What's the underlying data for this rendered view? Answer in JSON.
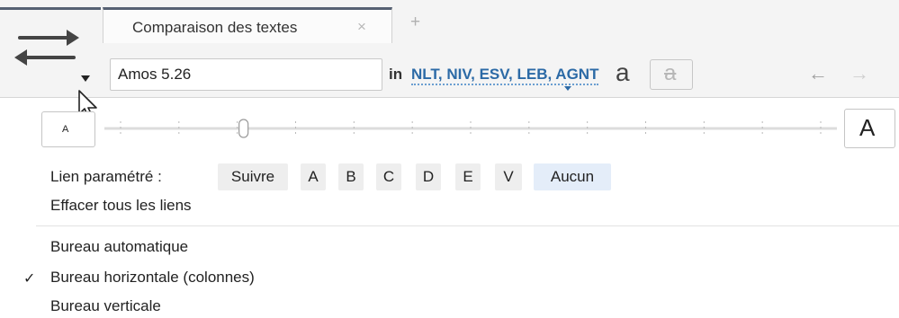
{
  "tab": {
    "title": "Comparaison des textes",
    "close_glyph": "×",
    "add_glyph": "+"
  },
  "reference": {
    "value": "Amos 5.26"
  },
  "versions": {
    "prefix": "in",
    "list": "NLT, NIV, ESV, LEB, AGNT"
  },
  "format": {
    "font_letter": "a",
    "strike_letter": "a"
  },
  "nav": {
    "back_glyph": "←",
    "forward_glyph": "→"
  },
  "font_size": {
    "small_label": "A",
    "large_label": "A",
    "slider_value_fraction": 0.19
  },
  "linking": {
    "label": "Lien paramétré :",
    "options": [
      "Suivre",
      "A",
      "B",
      "C",
      "D",
      "E",
      "V",
      "Aucun"
    ],
    "selected": "Aucun",
    "clear_label": "Effacer tous les liens"
  },
  "layout_menu": {
    "items": [
      "Bureau automatique",
      "Bureau horizontale (colonnes)",
      "Bureau verticale"
    ],
    "checked": "Bureau horizontale (colonnes)",
    "check_glyph": "✓"
  },
  "icons": {
    "swap": "swap-arrows-icon",
    "cursor": "mouse-cursor-icon"
  },
  "colors": {
    "accent_dark": "#566173",
    "link_blue": "#2c6aa6",
    "selected_chip": "#e4edf9"
  }
}
